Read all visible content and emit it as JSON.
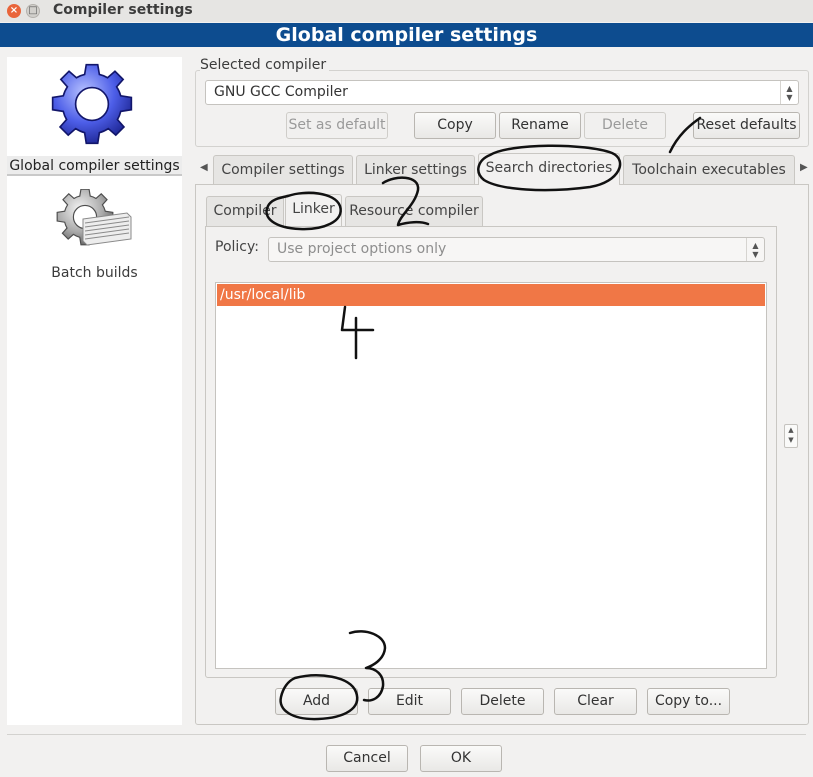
{
  "window": {
    "title": "Compiler settings"
  },
  "banner": {
    "title": "Global compiler settings"
  },
  "sidebar": {
    "items": [
      {
        "label": "Global compiler settings",
        "icon": "gear-icon",
        "selected": true
      },
      {
        "label": "Batch builds",
        "icon": "batch-builds-icon",
        "selected": false
      }
    ]
  },
  "compiler_group": {
    "caption": "Selected compiler",
    "selected_compiler": "GNU GCC Compiler",
    "buttons": {
      "set_default": "Set as default",
      "copy": "Copy",
      "rename": "Rename",
      "delete": "Delete",
      "reset_defaults": "Reset defaults"
    }
  },
  "tabs": {
    "compiler_settings": "Compiler settings",
    "linker_settings": "Linker settings",
    "search_directories": "Search directories",
    "toolchain_executables": "Toolchain executables",
    "active": "Search directories"
  },
  "subtabs": {
    "compiler": "Compiler",
    "linker": "Linker",
    "resource_compiler": "Resource compiler",
    "active": "Linker"
  },
  "policy": {
    "label": "Policy:",
    "value": "Use project options only"
  },
  "directories": {
    "items": [
      "/usr/local/lib"
    ],
    "selected_index": 0
  },
  "list_buttons": {
    "add": "Add",
    "edit": "Edit",
    "delete": "Delete",
    "clear": "Clear",
    "copy_to": "Copy to..."
  },
  "dialog_buttons": {
    "cancel": "Cancel",
    "ok": "OK"
  },
  "annotations": {
    "step1": "1",
    "step2": "2",
    "step3": "3",
    "step4": "4"
  },
  "colors": {
    "banner": "#0d4c8f",
    "selection": "#f07746",
    "window_bg": "#f2f1f0"
  }
}
